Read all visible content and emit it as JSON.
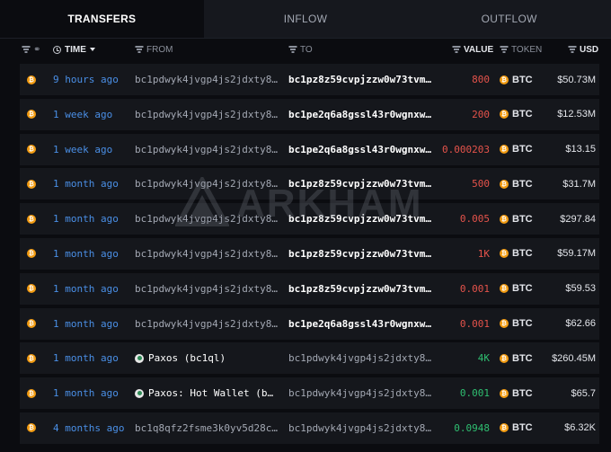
{
  "tabs": [
    {
      "label": "TRANSFERS",
      "active": true
    },
    {
      "label": "INFLOW",
      "active": false
    },
    {
      "label": "OUTFLOW",
      "active": false
    }
  ],
  "columns": {
    "time": "TIME",
    "from": "FROM",
    "to": "TO",
    "value": "VALUE",
    "token": "TOKEN",
    "usd": "USD"
  },
  "watermark": "ARKHAM",
  "colors": {
    "negative": "#e5534b",
    "positive": "#2fbf71",
    "btc": "#f39c12",
    "time_link": "#4a8fe6"
  },
  "rows": [
    {
      "time": "9 hours ago",
      "from": "bc1pdwyk4jvgp4js2jdxty8…",
      "to": "bc1pz8z59cvpjzzw0w73tvm…",
      "value": "800",
      "direction": "out",
      "token": "BTC",
      "usd": "$50.73M"
    },
    {
      "time": "1 week ago",
      "from": "bc1pdwyk4jvgp4js2jdxty8…",
      "to": "bc1pe2q6a8gssl43r0wgnxw…",
      "value": "200",
      "direction": "out",
      "token": "BTC",
      "usd": "$12.53M"
    },
    {
      "time": "1 week ago",
      "from": "bc1pdwyk4jvgp4js2jdxty8…",
      "to": "bc1pe2q6a8gssl43r0wgnxw…",
      "value": "0.000203",
      "direction": "out",
      "token": "BTC",
      "usd": "$13.15"
    },
    {
      "time": "1 month ago",
      "from": "bc1pdwyk4jvgp4js2jdxty8…",
      "to": "bc1pz8z59cvpjzzw0w73tvm…",
      "value": "500",
      "direction": "out",
      "token": "BTC",
      "usd": "$31.7M"
    },
    {
      "time": "1 month ago",
      "from": "bc1pdwyk4jvgp4js2jdxty8…",
      "to": "bc1pz8z59cvpjzzw0w73tvm…",
      "value": "0.005",
      "direction": "out",
      "token": "BTC",
      "usd": "$297.84"
    },
    {
      "time": "1 month ago",
      "from": "bc1pdwyk4jvgp4js2jdxty8…",
      "to": "bc1pz8z59cvpjzzw0w73tvm…",
      "value": "1K",
      "direction": "out",
      "token": "BTC",
      "usd": "$59.17M"
    },
    {
      "time": "1 month ago",
      "from": "bc1pdwyk4jvgp4js2jdxty8…",
      "to": "bc1pz8z59cvpjzzw0w73tvm…",
      "value": "0.001",
      "direction": "out",
      "token": "BTC",
      "usd": "$59.53"
    },
    {
      "time": "1 month ago",
      "from": "bc1pdwyk4jvgp4js2jdxty8…",
      "to": "bc1pe2q6a8gssl43r0wgnxw…",
      "value": "0.001",
      "direction": "out",
      "token": "BTC",
      "usd": "$62.66"
    },
    {
      "time": "1 month ago",
      "from": "Paxos (bc1ql)",
      "from_entity": true,
      "to": "bc1pdwyk4jvgp4js2jdxty8…",
      "value": "4K",
      "direction": "in",
      "token": "BTC",
      "usd": "$260.45M"
    },
    {
      "time": "1 month ago",
      "from": "Paxos: Hot Wallet (b…",
      "from_entity": true,
      "to": "bc1pdwyk4jvgp4js2jdxty8…",
      "value": "0.001",
      "direction": "in",
      "token": "BTC",
      "usd": "$65.7"
    },
    {
      "time": "4 months ago",
      "from": "bc1q8qfz2fsme3k0yv5d28c…",
      "to": "bc1pdwyk4jvgp4js2jdxty8…",
      "value": "0.0948",
      "direction": "in",
      "token": "BTC",
      "usd": "$6.32K"
    }
  ]
}
